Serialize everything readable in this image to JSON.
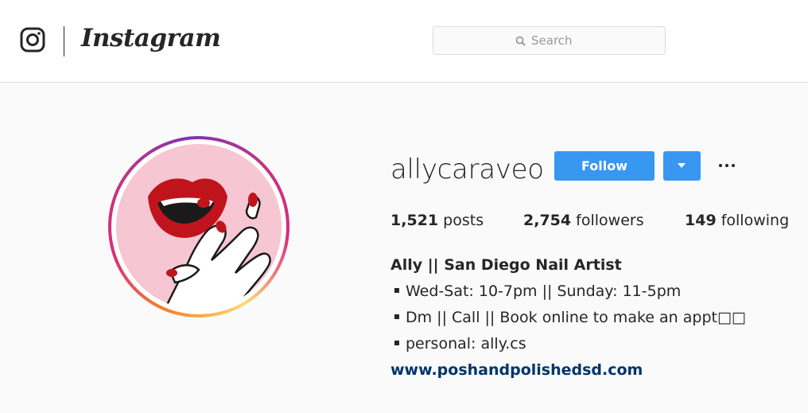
{
  "header": {
    "brand": "Instagram",
    "search_placeholder": "Search"
  },
  "profile": {
    "username": "allycaraveo",
    "follow_label": "Follow",
    "stats": {
      "posts_count": "1,521",
      "posts_label": "posts",
      "followers_count": "2,754",
      "followers_label": "followers",
      "following_count": "149",
      "following_label": "following"
    },
    "bio": {
      "name": "Ally || San Diego Nail Artist",
      "lines": [
        "Wed-Sat: 10-7pm || Sunday: 11-5pm",
        "Dm || Call || Book online to make an appt□□",
        "personal: ally.cs"
      ],
      "link": "www.poshandpolishedsd.com"
    }
  },
  "colors": {
    "follow_blue": "#3897f0",
    "link_blue": "#003569",
    "avatar_bg": "#f6c6d2",
    "lip_red": "#c0141c"
  }
}
